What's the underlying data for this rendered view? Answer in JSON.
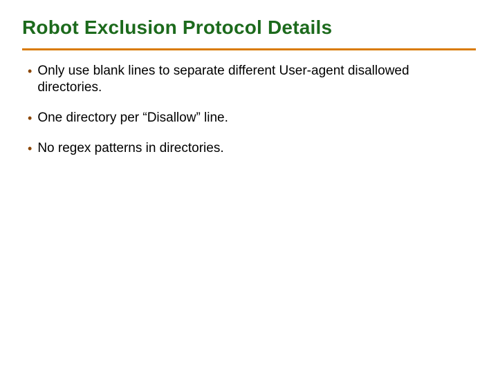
{
  "title": "Robot Exclusion Protocol Details",
  "bullets": [
    "Only use blank lines to separate different User-agent disallowed directories.",
    "One directory per “Disallow” line.",
    "No regex patterns in directories."
  ]
}
